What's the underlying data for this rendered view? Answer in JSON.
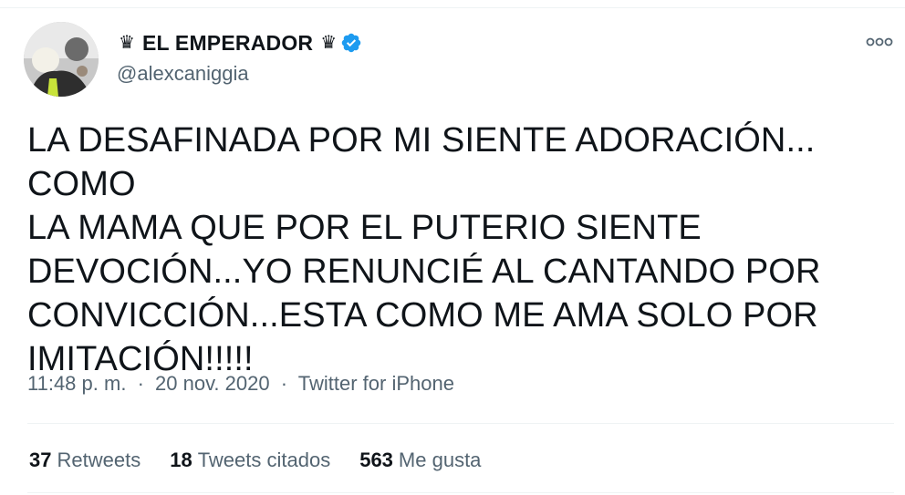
{
  "author": {
    "display_name": "EL EMPERADOR",
    "crown_left": "♛",
    "crown_right": "♛",
    "handle": "@alexcaniggia",
    "verified": true,
    "avatar_icon": "profile-photo"
  },
  "tweet": {
    "text_lines": [
      "LA DESAFINADA POR MI SIENTE ADORACIÓN... COMO",
      "LA MAMA QUE POR EL PUTERIO SIENTE",
      "DEVOCIÓN...YO RENUNCIÉ AL CANTANDO POR",
      "CONVICCIÓN...ESTA COMO ME AMA SOLO POR",
      "IMITACIÓN!!!!!"
    ],
    "time": "11:48 p. m.",
    "separator": "·",
    "date": "20 nov. 2020",
    "source": "Twitter for iPhone"
  },
  "stats": {
    "retweets_count": "37",
    "retweets_label": "Retweets",
    "quotes_count": "18",
    "quotes_label": "Tweets citados",
    "likes_count": "563",
    "likes_label": "Me gusta"
  },
  "colors": {
    "text_primary": "#0f1419",
    "text_secondary": "#536471",
    "verified_blue": "#1d9bf0",
    "divider": "#eff3f4"
  },
  "icons": {
    "more": "more-options-icon",
    "verified": "verified-badge-icon"
  }
}
